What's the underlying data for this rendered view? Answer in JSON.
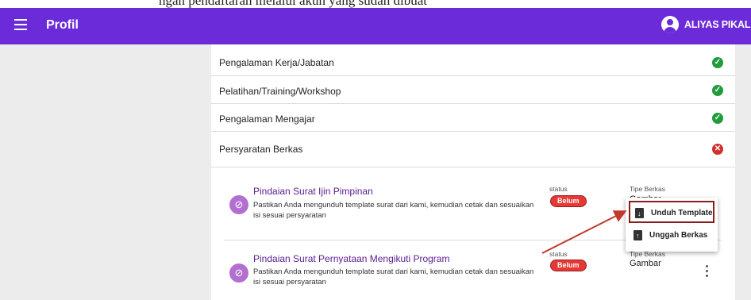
{
  "banner": {
    "text": "ngan pendaftaran melalui akun yang sudah dibuat"
  },
  "appbar": {
    "title": "Profil",
    "user": "ALIYAS PIKAL"
  },
  "sections": [
    {
      "label": "Pengalaman Kerja/Jabatan",
      "status": "complete"
    },
    {
      "label": "Pelatihan/Training/Workshop",
      "status": "complete"
    },
    {
      "label": "Pengalaman Mengajar",
      "status": "complete"
    },
    {
      "label": "Persyaratan Berkas",
      "status": "incomplete"
    }
  ],
  "documents": [
    {
      "title": "Pindaian Surat Ijin Pimpinan",
      "description": "Pastikan Anda mengunduh template surat dari kami, kemudian cetak dan sesuaikan isi sesuai persyaratan",
      "status_label": "status",
      "status": "Belum",
      "type_label": "Tipe Berkas",
      "type": "Gambar"
    },
    {
      "title": "Pindaian Surat Pernyataan Mengikuti Program",
      "description": "Pastikan Anda mengunduh template surat dari kami, kemudian cetak dan sesuaikan isi sesuai persyaratan",
      "status_label": "status",
      "status": "Belum",
      "type_label": "Tipe Berkas",
      "type": "Gambar"
    }
  ],
  "menu": {
    "download": "Unduh Template",
    "upload": "Unggah Berkas"
  },
  "colors": {
    "appbar": "#6c2bd9",
    "ok": "#1e9d3a",
    "bad": "#d32f2f",
    "badge": "#e53935",
    "highlight": "#8a1c1c",
    "doc_title": "#5a1d8f"
  },
  "icons": {
    "menu": "hamburger-icon",
    "user": "account-circle-icon",
    "ok": "check-circle-icon",
    "bad": "cancel-circle-icon",
    "doc": "paperclip-icon",
    "more": "kebab-menu-icon",
    "file": "file-icon"
  }
}
